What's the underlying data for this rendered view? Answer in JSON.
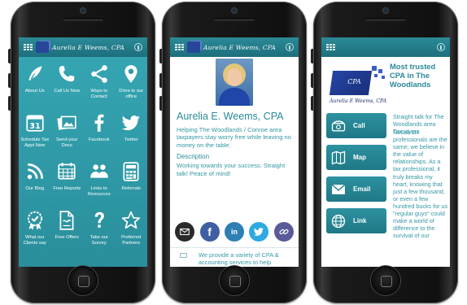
{
  "header": {
    "title": "Aurelia E Weems, CPA"
  },
  "colors": {
    "teal": "#2e9aa8",
    "teal_dark": "#1d6f7c",
    "text_teal": "#2a8a99",
    "logo_blue": "#27469a"
  },
  "grid": {
    "tiles": [
      {
        "label": "About Us",
        "icon": "quill-icon"
      },
      {
        "label": "Call Us Now",
        "icon": "phone-icon"
      },
      {
        "label": "Ways to Contact",
        "icon": "share-icon"
      },
      {
        "label": "Drive to our office",
        "icon": "map-pin-icon"
      },
      {
        "label": "Schedule Tax Appt Now",
        "icon": "calendar-icon"
      },
      {
        "label": "Send your Docs",
        "icon": "photos-icon"
      },
      {
        "label": "Facebook",
        "icon": "facebook-icon"
      },
      {
        "label": "Twitter",
        "icon": "twitter-icon"
      },
      {
        "label": "Our Blog",
        "icon": "rss-icon"
      },
      {
        "label": "Free Reports",
        "icon": "calendar-grid-icon"
      },
      {
        "label": "Links to Resources",
        "icon": "people-icon"
      },
      {
        "label": "Referrals",
        "icon": "calculator-icon"
      },
      {
        "label": "What our Clients say",
        "icon": "seal-icon"
      },
      {
        "label": "Free Offers",
        "icon": "document-icon"
      },
      {
        "label": "Take our Survey",
        "icon": "question-icon"
      },
      {
        "label": "Preferred Partners",
        "icon": "star-icon"
      }
    ]
  },
  "profile": {
    "name": "Aurelia E. Weems, CPA",
    "blurb": "Helping The Woodlands / Conroe area taxpayers stay worry free while leaving no money on the table.",
    "description_heading": "Description",
    "description": "Working towards your success. Straight talk! Peace of mind!",
    "social": [
      "email-icon",
      "facebook-icon",
      "linkedin-icon",
      "twitter-icon",
      "link-icon"
    ],
    "services_text": "We provide a variety of CPA & accounting services to help"
  },
  "contact": {
    "logo_text": "CPA",
    "logo_name": "Aurelia E Weems, CPA",
    "headline": "Most trusted CPA in The Woodlands",
    "subheadline": "Straight talk for The Woodlands area Taxpayers",
    "body": "Not all tax professionals are the same; we believe in the value of relationships. As a tax professional, it truly breaks my heart, knowing that just a few thousand, or even a few hundred bucks for us \"regular guys\" could make a world of difference to the survival of our",
    "buttons": [
      {
        "label": "Call",
        "icon": "phone-icon"
      },
      {
        "label": "Map",
        "icon": "map-icon"
      },
      {
        "label": "Email",
        "icon": "envelope-icon"
      },
      {
        "label": "Link",
        "icon": "globe-icon"
      }
    ]
  }
}
